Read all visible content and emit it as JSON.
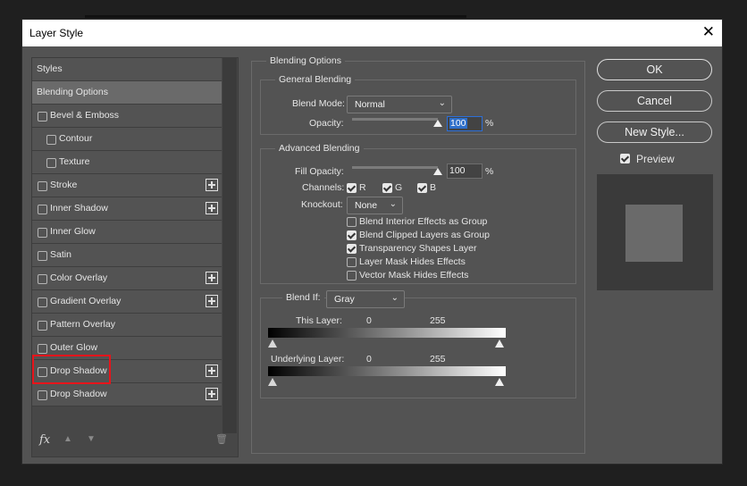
{
  "window": {
    "title": "Layer Style",
    "close_glyph": "✕"
  },
  "styles_list": {
    "items": [
      {
        "label": "Styles",
        "checkbox": false,
        "checked": false,
        "plus": false,
        "indent": false,
        "kind": "header"
      },
      {
        "label": "Blending Options",
        "checkbox": false,
        "checked": false,
        "plus": false,
        "indent": false,
        "kind": "selected"
      },
      {
        "label": "Bevel & Emboss",
        "checkbox": true,
        "checked": false,
        "plus": false,
        "indent": false
      },
      {
        "label": "Contour",
        "checkbox": true,
        "checked": false,
        "plus": false,
        "indent": true
      },
      {
        "label": "Texture",
        "checkbox": true,
        "checked": false,
        "plus": false,
        "indent": true
      },
      {
        "label": "Stroke",
        "checkbox": true,
        "checked": false,
        "plus": true,
        "indent": false
      },
      {
        "label": "Inner Shadow",
        "checkbox": true,
        "checked": false,
        "plus": true,
        "indent": false
      },
      {
        "label": "Inner Glow",
        "checkbox": true,
        "checked": false,
        "plus": false,
        "indent": false
      },
      {
        "label": "Satin",
        "checkbox": true,
        "checked": false,
        "plus": false,
        "indent": false
      },
      {
        "label": "Color Overlay",
        "checkbox": true,
        "checked": false,
        "plus": true,
        "indent": false
      },
      {
        "label": "Gradient Overlay",
        "checkbox": true,
        "checked": false,
        "plus": true,
        "indent": false
      },
      {
        "label": "Pattern Overlay",
        "checkbox": true,
        "checked": false,
        "plus": false,
        "indent": false
      },
      {
        "label": "Outer Glow",
        "checkbox": true,
        "checked": false,
        "plus": false,
        "indent": false
      },
      {
        "label": "Drop Shadow",
        "checkbox": true,
        "checked": false,
        "plus": true,
        "indent": false
      },
      {
        "label": "Drop Shadow",
        "checkbox": true,
        "checked": false,
        "plus": true,
        "indent": false
      }
    ],
    "footer_icons": {
      "fx": "fx",
      "up": "▲",
      "down": "▼",
      "trash": "🗑"
    }
  },
  "blending_options": {
    "section_title": "Blending Options",
    "general": {
      "title": "General Blending",
      "blend_mode_label": "Blend Mode:",
      "blend_mode_value": "Normal",
      "opacity_label": "Opacity:",
      "opacity_value": "100",
      "opacity_unit": "%",
      "opacity_level": 1.0
    },
    "advanced": {
      "title": "Advanced Blending",
      "fill_opacity_label": "Fill Opacity:",
      "fill_opacity_value": "100",
      "fill_opacity_unit": "%",
      "fill_opacity_level": 1.0,
      "channels_label": "Channels:",
      "channels": [
        {
          "label": "R",
          "checked": true
        },
        {
          "label": "G",
          "checked": true
        },
        {
          "label": "B",
          "checked": true
        }
      ],
      "knockout_label": "Knockout:",
      "knockout_value": "None",
      "options": [
        {
          "label": "Blend Interior Effects as Group",
          "checked": false
        },
        {
          "label": "Blend Clipped Layers as Group",
          "checked": true
        },
        {
          "label": "Transparency Shapes Layer",
          "checked": true
        },
        {
          "label": "Layer Mask Hides Effects",
          "checked": false
        },
        {
          "label": "Vector Mask Hides Effects",
          "checked": false
        }
      ]
    },
    "blend_if": {
      "label": "Blend If:",
      "value": "Gray",
      "this_layer_label": "This Layer:",
      "this_layer_low": "0",
      "this_layer_high": "255",
      "underlying_label": "Underlying Layer:",
      "underlying_low": "0",
      "underlying_high": "255"
    }
  },
  "buttons": {
    "ok": "OK",
    "cancel": "Cancel",
    "new_style": "New Style...",
    "preview_label": "Preview",
    "preview_checked": true
  },
  "colors": {
    "dialog_bg": "#535353",
    "highlight_red": "#e8141b",
    "focus_blue": "#2f6fc9"
  }
}
